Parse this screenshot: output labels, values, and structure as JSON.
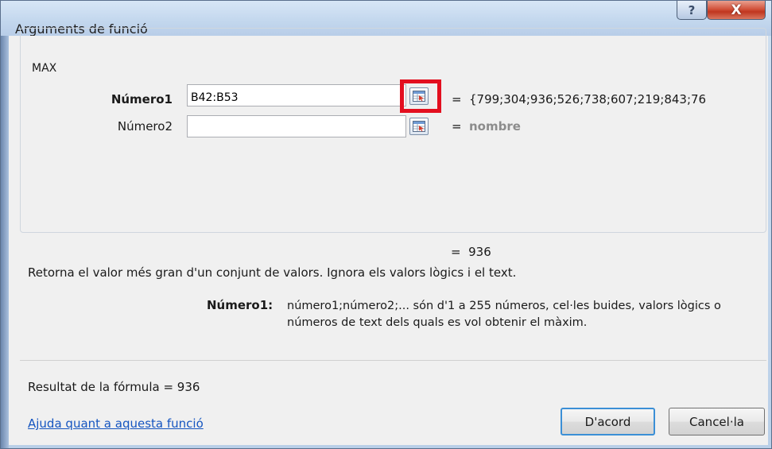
{
  "window": {
    "title": "Arguments de funció",
    "help_glyph": "?",
    "close_glyph": "X"
  },
  "function_name": "MAX",
  "arguments": [
    {
      "label": "Número1",
      "value": "B42:B53",
      "eq": "=",
      "result": "{799;304;936;526;738;607;219;843;76"
    },
    {
      "label": "Número2",
      "value": "",
      "eq": "=",
      "result": "nombre"
    }
  ],
  "ref_button_icon": "collapse-dialog-icon",
  "result": {
    "eq": "=",
    "value": "936"
  },
  "description": "Retorna el valor més gran d'un conjunt de valors. Ignora els valors lògics i el text.",
  "param_help": {
    "name": "Número1:",
    "text": "número1;número2;... són d'1 a 255 números, cel·les buides, valors lògics o números de text dels quals es vol obtenir el màxim."
  },
  "formula_result": "Resultat de la fórmula =  936",
  "help_link": "Ajuda quant a aquesta funció",
  "buttons": {
    "ok": "D'acord",
    "cancel": "Cancel·la"
  },
  "colors": {
    "highlight": "#e30f1f",
    "link": "#1555c0",
    "close_button": "#c0361f",
    "default_button_border": "#3b8fd6"
  }
}
